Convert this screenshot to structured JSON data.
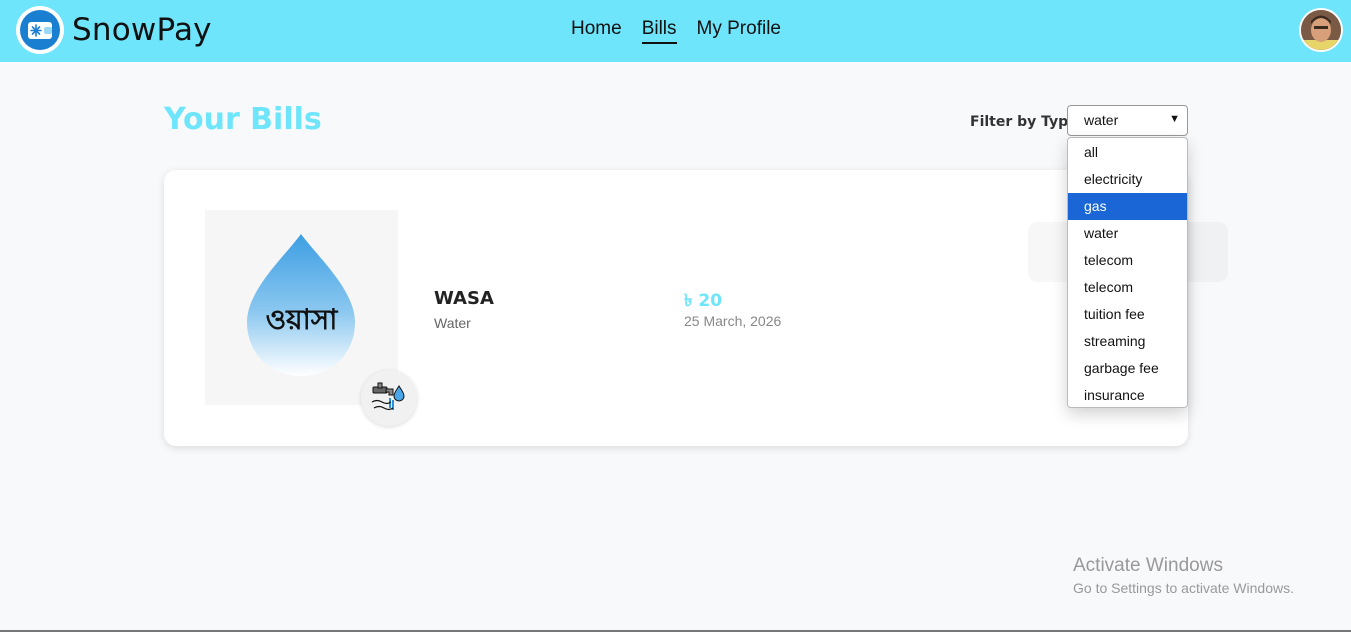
{
  "brand": {
    "name": "SnowPay",
    "logo_icon": "wallet-snowflake-icon"
  },
  "nav": [
    {
      "label": "Home",
      "active": false
    },
    {
      "label": "Bills",
      "active": true
    },
    {
      "label": "My Profile",
      "active": false
    }
  ],
  "user": {
    "avatar_icon": "user-avatar"
  },
  "page": {
    "title": "Your Bills"
  },
  "filter": {
    "label": "Filter by Type:",
    "selected": "water",
    "highlighted": "gas",
    "options": [
      "all",
      "electricity",
      "gas",
      "water",
      "telecom",
      "telecom",
      "tuition fee",
      "streaming",
      "garbage fee",
      "insurance"
    ]
  },
  "bill": {
    "logo_text": "ওয়াসা",
    "name": "WASA",
    "type": "Water",
    "amount": "৳ 20",
    "due_date": "25 March, 2026",
    "type_icon": "water-tap-icon"
  },
  "watermark": {
    "title": "Activate Windows",
    "subtitle": "Go to Settings to activate Windows."
  },
  "colors": {
    "accent": "#6ee5fb",
    "highlight": "#1a66d6",
    "brand_blue": "#1b7fd1"
  }
}
